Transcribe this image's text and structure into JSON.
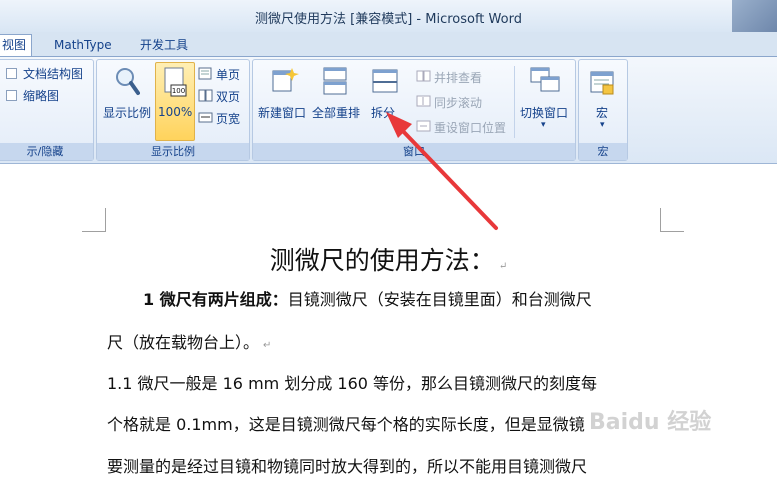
{
  "window": {
    "title": "测微尺使用方法 [兼容模式] - Microsoft Word"
  },
  "tabs": [
    {
      "label": "视图",
      "active": true
    },
    {
      "label": "MathType",
      "active": false
    },
    {
      "label": "开发工具",
      "active": false
    }
  ],
  "ribbon": {
    "show_hide": {
      "label": "示/隐藏",
      "doc_map": "文档结构图",
      "thumbnails": "缩略图"
    },
    "zoom": {
      "label": "显示比例",
      "zoom_btn": "显示比例",
      "pct_btn": "100%",
      "pct_icon_text": "100",
      "one_page": "单页",
      "two_pages": "双页",
      "page_width": "页宽"
    },
    "window": {
      "label": "窗口",
      "new_window": "新建窗口",
      "arrange_all": "全部重排",
      "split": "拆分",
      "side_by_side": "并排查看",
      "sync_scroll": "同步滚动",
      "reset_pos": "重设窗口位置",
      "switch_window": "切换窗口"
    },
    "macros": {
      "label": "宏",
      "macros_btn": "宏"
    }
  },
  "document": {
    "title": "测微尺的使用方法：",
    "para1_bold": "1 微尺有两片组成：",
    "para1_rest": "目镜测微尺（安装在目镜里面）和台测微尺",
    "para1_line2": "尺（放在载物台上）。",
    "para2_line1": "1.1 微尺一般是 16 mm 划分成 160 等份，那么目镜测微尺的刻度每",
    "para2_line2": "个格就是 0.1mm，这是目镜测微尺每个格的实际长度，但是显微镜",
    "para2_line3": "要测量的是经过目镜和物镜同时放大得到的，所以不能用目镜测微尺",
    "paragraph_mark": "↵"
  },
  "watermark": "Baidu 经验",
  "colors": {
    "annotation_arrow": "#e8383a",
    "ribbon_text": "#15428b"
  }
}
